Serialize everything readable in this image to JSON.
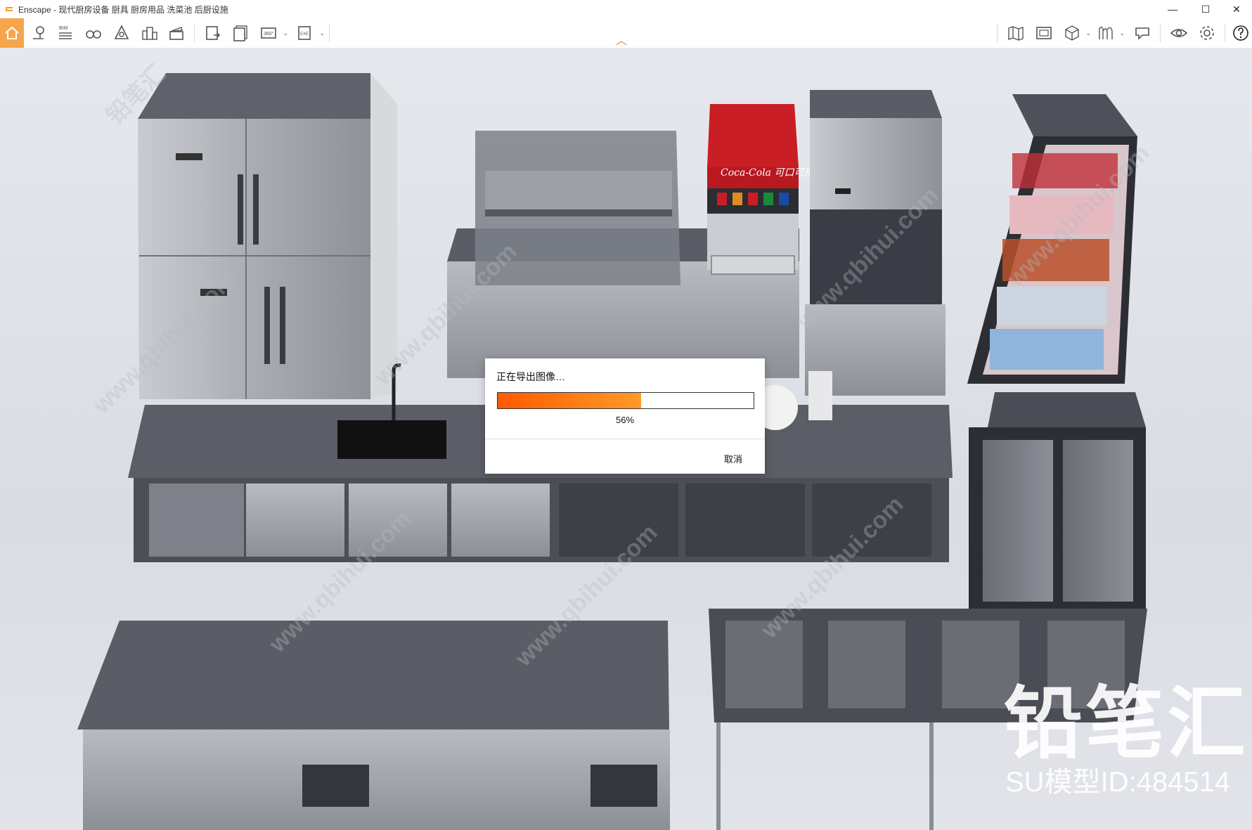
{
  "window": {
    "app_name": "Enscape",
    "title": "Enscape - 现代厨房设备 厨具 厨房用品 洗菜池 后厨设施",
    "controls": {
      "minimize": "—",
      "maximize": "☐",
      "close": "✕"
    }
  },
  "toolbar": {
    "bim_label": "BIM",
    "icons": [
      "home-icon",
      "location-pin-icon",
      "bim-list-icon",
      "binoculars-icon",
      "atmosphere-icon",
      "asset-library-icon",
      "clapperboard-icon",
      "screenshot-icon",
      "batch-render-icon",
      "panorama-360-icon",
      "export-exe-icon",
      "map-icon",
      "view-management-icon",
      "cube-view-icon",
      "collaborative-annotation-icon",
      "chat-icon",
      "visual-settings-eye-icon",
      "settings-gear-icon",
      "help-icon"
    ],
    "panorama_label": "360°",
    "exe_label": "EXE",
    "accent_color": "#f7a54a"
  },
  "dialog": {
    "title": "正在导出图像…",
    "progress": 0.56,
    "progress_text": "56%",
    "cancel_label": "取消"
  },
  "watermark": {
    "brand": "铅笔汇",
    "model_id": "SU模型ID:484514",
    "repeat_text": "www.qbihui.com",
    "repeat_text2": "铅笔汇"
  },
  "scene": {
    "products": {
      "cola_brand": "Coca-Cola 可口可乐"
    }
  }
}
